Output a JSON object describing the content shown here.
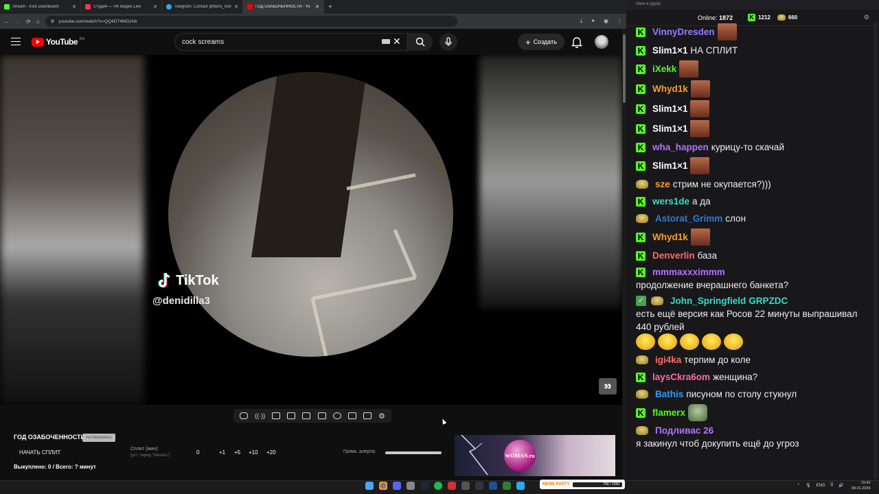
{
  "browser": {
    "tabs": [
      {
        "label": "Stream - Kick Dashboard",
        "color": "#53fc18"
      },
      {
        "label": "Студия — VK Видео Live",
        "color": "#ff3347"
      },
      {
        "label": "Telegram: Contact @boris_roch",
        "color": "#2aabee"
      },
      {
        "label": "ГОД ОЗАБОЧЕННОСТИ - Yo",
        "color": "#ff0000",
        "active": true
      }
    ],
    "url": "youtube.com/watch?v=QQ4DT4MGzNk"
  },
  "youtube": {
    "logo": "YouTube",
    "country": "RU",
    "search_value": "cock screams",
    "create_label": "Создать"
  },
  "video": {
    "watermark": "TikTok",
    "username": "@denidilla3"
  },
  "panel": {
    "title": "ГОД ОЗАБОЧЕННОСТИ",
    "badge": "Активировать",
    "start_split": "НАЧАТЬ СПЛИТ",
    "split_label": "Сплит (мин):",
    "split_hint": "(уст. перед \"Начать\")",
    "split_value": "0",
    "increments": [
      "+1",
      "+5",
      "+10",
      "+20"
    ],
    "volume_label": "Громк. алерта:",
    "bought": "Выкуплено: 0 / Всего: ? минут",
    "ad_text": "WOMAN.ru"
  },
  "chat": {
    "window_title": "Окно в дурку",
    "online_label": "Online:",
    "online_count": "1872",
    "kick_count": "1212",
    "gold_count": "660",
    "messages": [
      {
        "badge": "kick",
        "user": "VinnyDresden",
        "color": "#9b7bff",
        "text": "",
        "emote": "face"
      },
      {
        "badge": "kick",
        "user": "Slim1×1",
        "color": "#ffffff",
        "text": "НА СПЛИТ"
      },
      {
        "badge": "kick",
        "user": "iXekk",
        "color": "#53fc18",
        "text": "",
        "emote": "face"
      },
      {
        "badge": "kick",
        "user": "Whyd1k",
        "color": "#ff9b26",
        "text": "",
        "emote": "face"
      },
      {
        "badge": "kick",
        "user": "Slim1×1",
        "color": "#ffffff",
        "text": "",
        "emote": "face"
      },
      {
        "badge": "kick",
        "user": "Slim1×1",
        "color": "#ffffff",
        "text": "",
        "emote": "face"
      },
      {
        "badge": "kick",
        "user": "wha_happen",
        "color": "#b570ff",
        "text": "курицу-то скачай"
      },
      {
        "badge": "kick",
        "user": "Slim1×1",
        "color": "#ffffff",
        "text": "",
        "emote": "face"
      },
      {
        "badge": "pepe",
        "user": "sze",
        "color": "#ff9b26",
        "text": "стрим не окупается?)))"
      },
      {
        "badge": "kick",
        "user": "wers1de",
        "color": "#3ddac3",
        "text": "а да"
      },
      {
        "badge": "pepe",
        "user": "Astorat_Grimm",
        "color": "#2d7bd6",
        "text": "слон"
      },
      {
        "badge": "kick",
        "user": "Whyd1k",
        "color": "#ff9b26",
        "text": "",
        "emote": "face"
      },
      {
        "badge": "kick",
        "user": "Denverlin",
        "color": "#ff6b6b",
        "text": "база"
      },
      {
        "badge": "kick",
        "user": "mmmaxxximmm",
        "color": "#b570ff",
        "text": "продолжение вчерашнего банкета?"
      },
      {
        "badge": "check-pepe",
        "user": "John_Springfield",
        "color": "#3ddac3",
        "mention": "GRPZDC",
        "text": "есть ещё версия как Росов 22 минуты выпрашивал 440 рублей",
        "emote": "lol5"
      },
      {
        "badge": "pepe",
        "user": "igi4ka",
        "color": "#ff6b6b",
        "text": "терпим до коле"
      },
      {
        "badge": "kick",
        "user": "laysCkra6om",
        "color": "#ff6b9e",
        "text": "женщина?"
      },
      {
        "badge": "pepe",
        "user": "Bathis",
        "color": "#2d9cff",
        "text": "писуном по столу стукнул"
      },
      {
        "badge": "kick",
        "user": "flamerx",
        "color": "#53fc18",
        "text": "",
        "emote": "frog"
      },
      {
        "badge": "pepe",
        "user": "Подливас 26",
        "color": "#b570ff",
        "text": "я закинул чтоб докупить ещё до угроз"
      }
    ]
  },
  "taskbar": {
    "meme_label": "MEME PARTY",
    "meme_progress": "756 / 1590",
    "lang": "ENG",
    "time": "15:42",
    "date": "08.01.2026"
  }
}
